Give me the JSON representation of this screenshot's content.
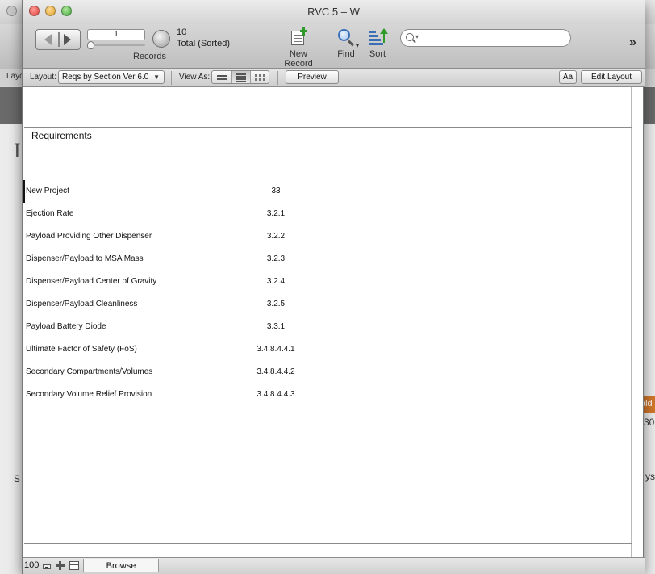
{
  "window": {
    "title": "RVC 5 – W"
  },
  "toolbar": {
    "current_record": "1",
    "found_count": "10",
    "found_status": "Total (Sorted)",
    "records_label": "Records",
    "new_record_label": "New Record",
    "find_label": "Find",
    "sort_label": "Sort",
    "search_placeholder": "",
    "overflow": "»"
  },
  "layoutbar": {
    "layout_label": "Layout:",
    "layout_value": "Reqs by Section Ver 6.0",
    "view_as_label": "View As:",
    "view_as_selected": "list",
    "preview_label": "Preview",
    "aa_label": "Aa",
    "edit_layout_label": "Edit Layout"
  },
  "report": {
    "title": "Requirements",
    "rows": [
      {
        "name": "New Project",
        "section": "33"
      },
      {
        "name": "Ejection Rate",
        "section": "3.2.1"
      },
      {
        "name": "Payload Providing Other Dispenser",
        "section": "3.2.2"
      },
      {
        "name": "Dispenser/Payload to MSA Mass",
        "section": "3.2.3"
      },
      {
        "name": "Dispenser/Payload Center of Gravity",
        "section": "3.2.4"
      },
      {
        "name": "Dispenser/Payload Cleanliness",
        "section": "3.2.5"
      },
      {
        "name": "Payload Battery Diode",
        "section": "3.3.1"
      },
      {
        "name": "Ultimate Factor of Safety (FoS)",
        "section": "3.4.8.4.4.1"
      },
      {
        "name": "Secondary Compartments/Volumes",
        "section": "3.4.8.4.4.2"
      },
      {
        "name": "Secondary Volume Relief Provision",
        "section": "3.4.8.4.4.3"
      }
    ]
  },
  "statusbar": {
    "zoom": "100",
    "mode": "Browse"
  },
  "background_window": {
    "layout_fragment": "Layo",
    "big_letter": "I",
    "letter_s": "S",
    "frag_right_1": "ald",
    "frag_right_2": "30",
    "frag_right_3": "ys"
  },
  "colors": {
    "accent_orange": "#d2782a",
    "add_green": "#2f9a2a",
    "icon_blue": "#3b6fb5"
  }
}
